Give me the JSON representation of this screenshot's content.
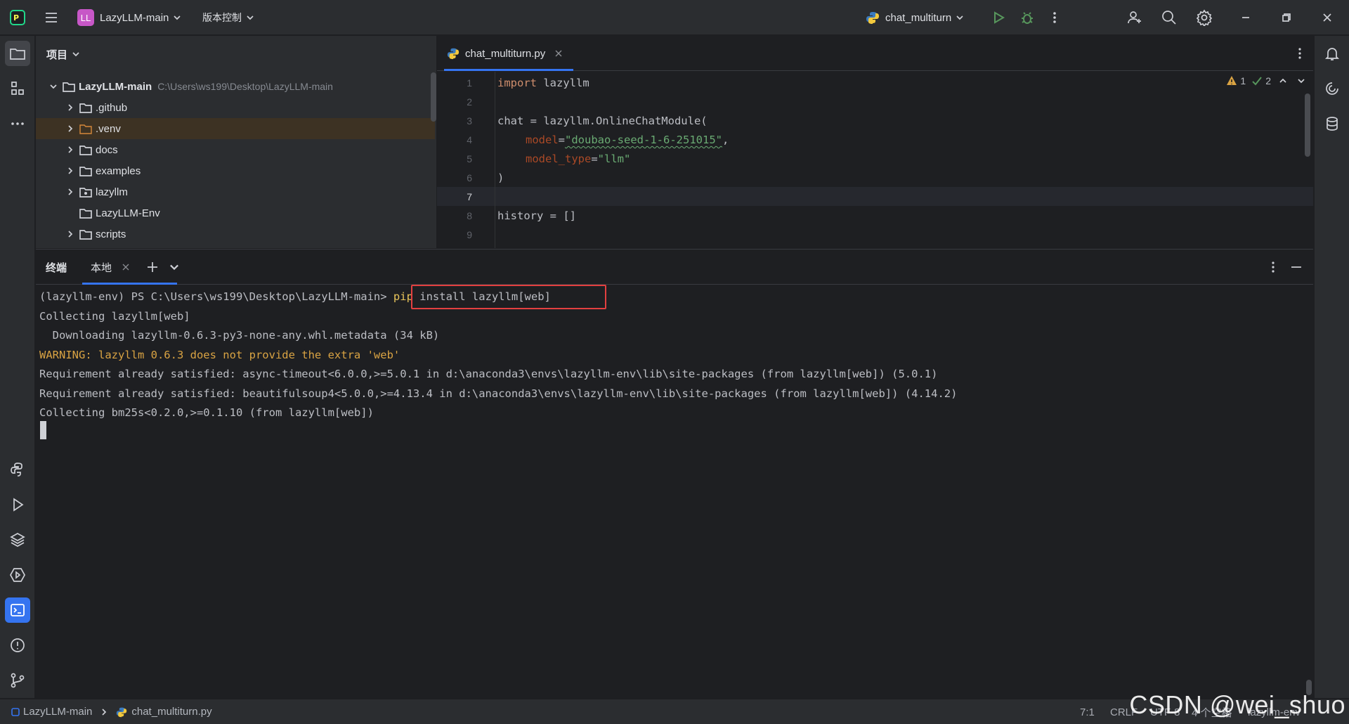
{
  "titlebar": {
    "project_badge": "LL",
    "project_name": "LazyLLM-main",
    "vcs_label": "版本控制",
    "run_config": "chat_multiturn"
  },
  "project_panel": {
    "header": "项目",
    "root": {
      "name": "LazyLLM-main",
      "path": "C:\\Users\\ws199\\Desktop\\LazyLLM-main"
    },
    "items": [
      {
        "name": ".github",
        "expandable": true
      },
      {
        "name": ".venv",
        "expandable": true,
        "highlighted": true
      },
      {
        "name": "docs",
        "expandable": true
      },
      {
        "name": "examples",
        "expandable": true
      },
      {
        "name": "lazyllm",
        "expandable": true
      },
      {
        "name": "LazyLLM-Env",
        "expandable": false
      },
      {
        "name": "scripts",
        "expandable": true
      }
    ]
  },
  "editor": {
    "tab": "chat_multiturn.py",
    "warnings": "1",
    "checks": "2",
    "line_numbers": [
      "1",
      "2",
      "3",
      "4",
      "5",
      "6",
      "7",
      "8",
      "9"
    ],
    "code": {
      "l1_kw": "import",
      "l1_rest": " lazyllm",
      "l3": "chat = lazyllm.OnlineChatModule(",
      "l4_param": "model",
      "l4_eq": "=",
      "l4_str": "\"doubao-seed-1-6-251015\"",
      "l4_end": ",",
      "l5_param": "model_type",
      "l5_eq": "=",
      "l5_str": "\"llm\"",
      "l6": ")",
      "l8": "history = []"
    }
  },
  "terminal": {
    "title": "终端",
    "tab_local": "本地",
    "prompt": "(lazyllm-env) PS C:\\Users\\ws199\\Desktop\\LazyLLM-main> ",
    "cmd_pip": "pip",
    "cmd_rest": " install lazyllm[web]",
    "lines": [
      "Collecting lazyllm[web]",
      "  Downloading lazyllm-0.6.3-py3-none-any.whl.metadata (34 kB)",
      "WARNING: lazyllm 0.6.3 does not provide the extra 'web'",
      "Requirement already satisfied: async-timeout<6.0.0,>=5.0.1 in d:\\anaconda3\\envs\\lazyllm-env\\lib\\site-packages (from lazyllm[web]) (5.0.1)",
      "Requirement already satisfied: beautifulsoup4<5.0.0,>=4.13.4 in d:\\anaconda3\\envs\\lazyllm-env\\lib\\site-packages (from lazyllm[web]) (4.14.2)",
      "Collecting bm25s<0.2.0,>=0.1.10 (from lazyllm[web])"
    ]
  },
  "statusbar": {
    "project": "LazyLLM-main",
    "file": "chat_multiturn.py",
    "position": "7:1",
    "line_ending": "CRLF",
    "encoding": "UTF-8",
    "indent": "4 个空格",
    "interpreter": "lazyllm-env"
  },
  "watermark": "CSDN @wei_shuo",
  "colors": {
    "accent": "#3574f0",
    "warning": "#d9a343",
    "highlight_box": "#e34040",
    "project_badge": "#c757c7"
  }
}
